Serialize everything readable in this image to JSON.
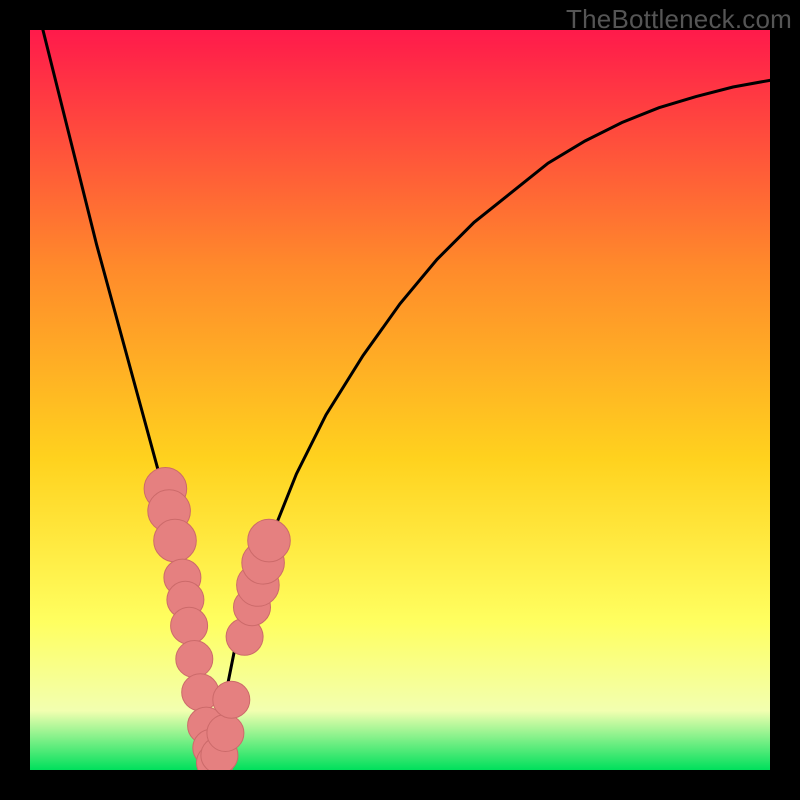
{
  "watermark": "TheBottleneck.com",
  "colors": {
    "frame": "#000000",
    "grad_top": "#ff1a4b",
    "grad_upper_mid": "#ff8a2b",
    "grad_mid": "#ffd21e",
    "grad_lower_mid": "#ffff60",
    "grad_lower": "#f2ffb0",
    "grad_bottom": "#00e05c",
    "curve": "#000000",
    "marker_fill": "#e58080",
    "marker_stroke": "#cc6a6a"
  },
  "chart_data": {
    "type": "line",
    "title": "",
    "xlabel": "",
    "ylabel": "",
    "xlim": [
      0,
      100
    ],
    "ylim": [
      0,
      100
    ],
    "grid": false,
    "legend": false,
    "notch_x": 25,
    "series": [
      {
        "name": "v-curve",
        "x": [
          0,
          3,
          6,
          9,
          12,
          15,
          18,
          20,
          22,
          24,
          25,
          26,
          28,
          32,
          36,
          40,
          45,
          50,
          55,
          60,
          65,
          70,
          75,
          80,
          85,
          90,
          95,
          100
        ],
        "y": [
          107,
          95,
          83,
          71,
          60,
          49,
          38,
          30,
          21,
          10,
          0,
          8,
          18,
          30,
          40,
          48,
          56,
          63,
          69,
          74,
          78,
          82,
          85,
          87.5,
          89.5,
          91,
          92.3,
          93.2
        ]
      }
    ],
    "markers": [
      {
        "x": 18.3,
        "y": 38,
        "r": 2.3
      },
      {
        "x": 18.8,
        "y": 35,
        "r": 2.3
      },
      {
        "x": 19.6,
        "y": 31,
        "r": 2.3
      },
      {
        "x": 20.6,
        "y": 26,
        "r": 2.0
      },
      {
        "x": 21.0,
        "y": 23,
        "r": 2.0
      },
      {
        "x": 21.5,
        "y": 19.5,
        "r": 2.0
      },
      {
        "x": 22.2,
        "y": 15,
        "r": 2.0
      },
      {
        "x": 23.0,
        "y": 10.5,
        "r": 2.0
      },
      {
        "x": 23.8,
        "y": 6,
        "r": 2.0
      },
      {
        "x": 24.5,
        "y": 3,
        "r": 2.0
      },
      {
        "x": 25.0,
        "y": 1,
        "r": 2.0
      },
      {
        "x": 25.6,
        "y": 2,
        "r": 2.0
      },
      {
        "x": 26.4,
        "y": 5,
        "r": 2.0
      },
      {
        "x": 27.2,
        "y": 9.5,
        "r": 2.0
      },
      {
        "x": 29.0,
        "y": 18,
        "r": 2.0
      },
      {
        "x": 30.0,
        "y": 22,
        "r": 2.0
      },
      {
        "x": 30.8,
        "y": 25,
        "r": 2.3
      },
      {
        "x": 31.5,
        "y": 28,
        "r": 2.3
      },
      {
        "x": 32.3,
        "y": 31,
        "r": 2.3
      }
    ]
  }
}
